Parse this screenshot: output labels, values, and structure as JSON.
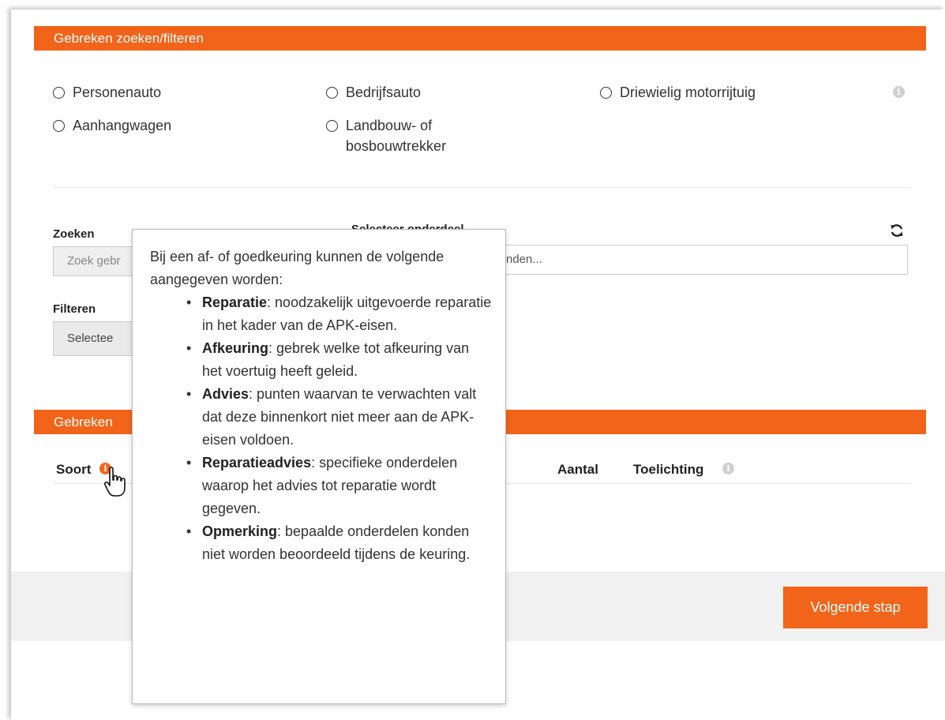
{
  "search_section": {
    "title": "Gebreken zoeken/filteren",
    "vehicle_types": [
      "Personenauto",
      "Bedrijfsauto",
      "Driewielig motorrijtuig",
      "Aanhangwagen",
      "Landbouw- of bosbouwtrekker"
    ],
    "search_label": "Zoeken",
    "search_placeholder": "Zoek gebr",
    "select_label": "Selecteer onderdeel",
    "select_placeholder": "nden...",
    "filter_label": "Filteren",
    "filter_value": "Selectee"
  },
  "defects_section": {
    "title": "Gebreken",
    "columns": {
      "soort": "Soort",
      "aantal": "Aantal",
      "toelichting": "Toelichting"
    }
  },
  "footer": {
    "next_button": "Volgende stap"
  },
  "tooltip": {
    "intro": "Bij een af- of goedkeuring kunnen de volgende aangegeven worden:",
    "items": [
      {
        "term": "Reparatie",
        "desc": ": noodzakelijk uitgevoerde reparatie in het kader van de APK-eisen."
      },
      {
        "term": "Afkeuring",
        "desc": ": gebrek welke tot afkeuring van het voertuig heeft geleid."
      },
      {
        "term": "Advies",
        "desc": ": punten waarvan te verwachten valt dat deze binnenkort niet meer aan de APK-eisen voldoen."
      },
      {
        "term": "Reparatieadvies",
        "desc": ": specifieke onderdelen waarop het advies tot reparatie wordt gegeven."
      },
      {
        "term": "Opmerking",
        "desc": ": bepaalde onderdelen konden niet worden beoordeeld tijdens de keuring."
      }
    ]
  },
  "colors": {
    "accent": "#f26419",
    "info_grey": "#cfcfcf"
  },
  "icons": {
    "info": "info-icon",
    "refresh": "refresh-icon",
    "cursor": "hand-pointer-icon"
  }
}
